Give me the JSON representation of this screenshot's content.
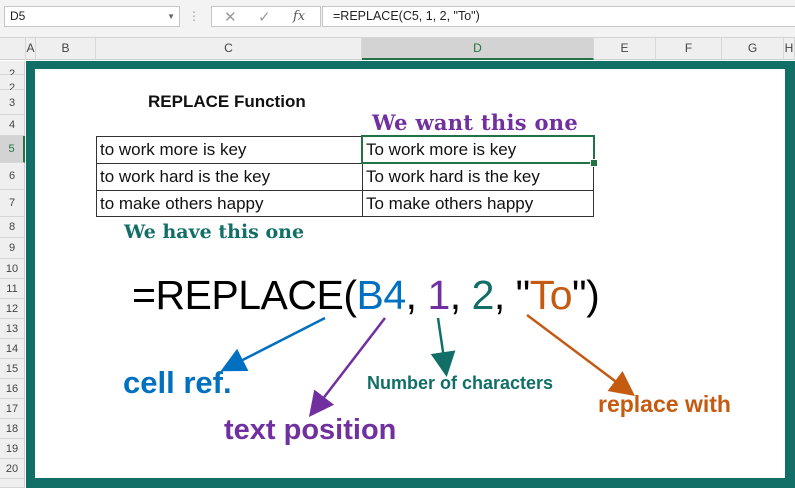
{
  "formula_bar": {
    "name_box": "D5",
    "cancel_icon": "✕",
    "enter_icon": "✓",
    "fx_label": "fx",
    "formula": "=REPLACE(C5, 1, 2, \"To\")"
  },
  "columns": [
    "A",
    "B",
    "C",
    "D",
    "E",
    "F",
    "G",
    "H"
  ],
  "rows": [
    "2",
    "3",
    "4",
    "5",
    "6",
    "7",
    "8",
    "9",
    "10",
    "11",
    "12",
    "13",
    "14",
    "15",
    "16",
    "17",
    "18",
    "19",
    "20"
  ],
  "sheet": {
    "title": "REPLACE Function",
    "want_label": "We want this one",
    "have_label": "We have this one",
    "table": [
      {
        "original": "to work more is key",
        "replaced": "To work more is key"
      },
      {
        "original": "to work hard is the key",
        "replaced": "To work hard is the key"
      },
      {
        "original": "to make others happy",
        "replaced": "To make others happy"
      }
    ],
    "formula_display": {
      "prefix": "=REPLACE(",
      "ref": "B4",
      "sep1": ", ",
      "pos": "1",
      "sep2": ", ",
      "num": "2",
      "sep3": ", \"",
      "repl": "To",
      "suffix": "\")"
    },
    "annotations": {
      "cell_ref": "cell ref.",
      "text_position": "text position",
      "number_of_characters": "Number of characters",
      "replace_with": "replace with"
    }
  },
  "colors": {
    "frame": "#116f67",
    "blue": "#0070c0",
    "purple": "#7030a0",
    "teal": "#116f67",
    "orange": "#c55a11",
    "selection": "#217346"
  }
}
